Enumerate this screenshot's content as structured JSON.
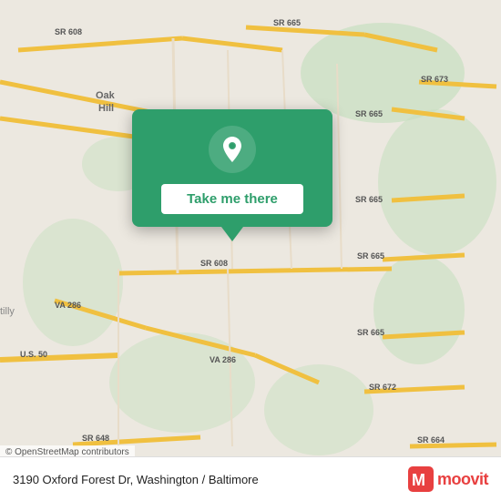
{
  "map": {
    "background_color": "#e8e0d8",
    "copyright": "© OpenStreetMap contributors"
  },
  "popup": {
    "button_label": "Take me there",
    "background_color": "#2e9e6b"
  },
  "bottom_bar": {
    "address": "3190 Oxford Forest Dr, Washington / Baltimore",
    "moovit_label": "moovit"
  },
  "roads": [
    {
      "label": "SR 608",
      "color": "#f5c842"
    },
    {
      "label": "SR 665",
      "color": "#f5c842"
    },
    {
      "label": "SR 673",
      "color": "#f5c842"
    },
    {
      "label": "SR 672",
      "color": "#f5c842"
    },
    {
      "label": "SR 664",
      "color": "#f5c842"
    },
    {
      "label": "VA 286",
      "color": "#f5c842"
    },
    {
      "label": "U.S. 50",
      "color": "#f5c842"
    },
    {
      "label": "Oak Hill",
      "color": "#555"
    }
  ]
}
